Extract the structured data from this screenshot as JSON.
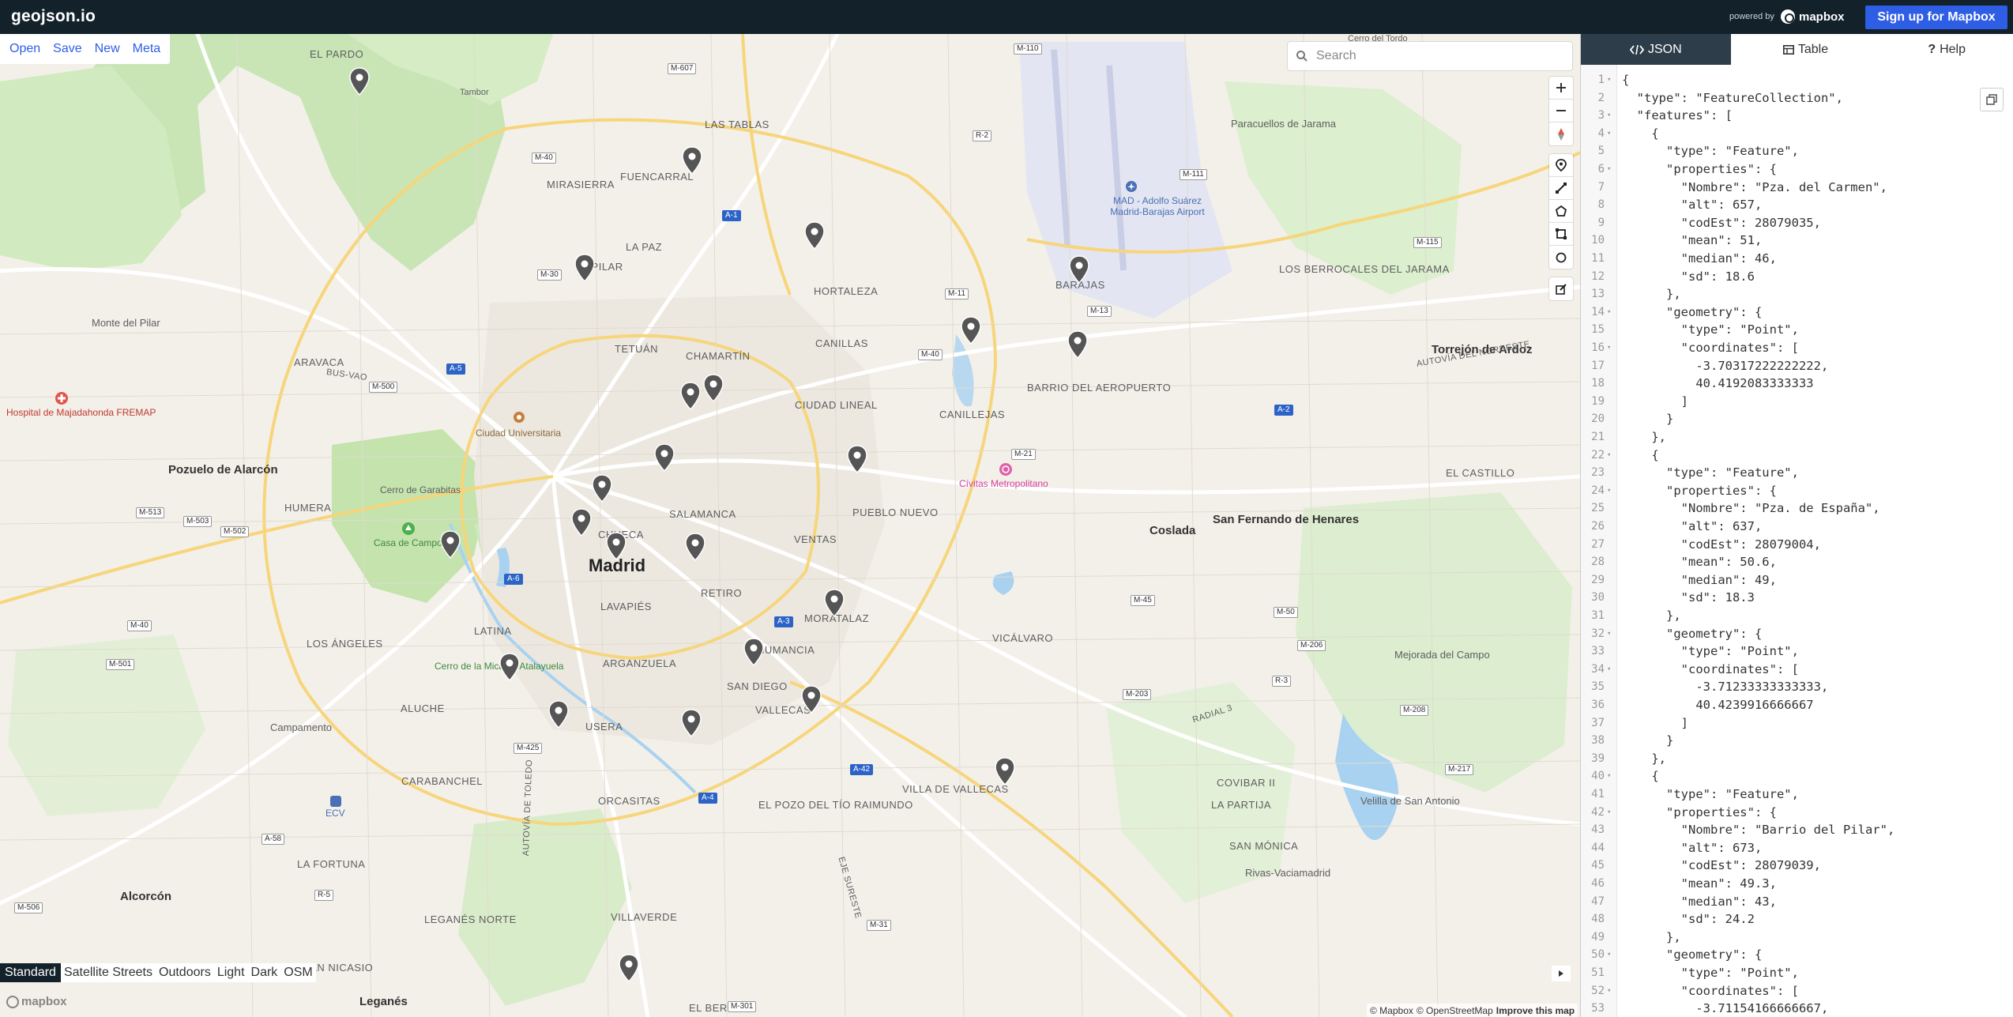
{
  "app": {
    "logo": "geojson.io",
    "powered_by": "powered by",
    "brand": "mapbox",
    "signup_label": "Sign up for Mapbox"
  },
  "file_menu": [
    "Open",
    "Save",
    "New",
    "Meta"
  ],
  "search": {
    "placeholder": "Search"
  },
  "map_styles": {
    "active": "Standard",
    "items": [
      "Standard",
      "Satellite Streets",
      "Outdoors",
      "Light",
      "Dark",
      "OSM"
    ]
  },
  "attribution": {
    "mapbox": "© Mapbox",
    "osm": "© OpenStreetMap",
    "improve": "Improve this map",
    "wordmark": "mapbox"
  },
  "map_labels": {
    "madrid": "Madrid",
    "places": [
      "EL PARDO",
      "LAS TABLAS",
      "FUENCARRAL",
      "MIRASIERRA",
      "EL PILAR",
      "LA PAZ",
      "HORTALEZA",
      "BARAJAS",
      "TETUÁN",
      "CHAMARTÍN",
      "CANILLAS",
      "CANILLEJAS",
      "CIUDAD LINEAL",
      "BARRIO DEL AEROPUERTO",
      "SALAMANCA",
      "PUEBLO NUEVO",
      "VENTAS",
      "RETIRO",
      "MORATALAZ",
      "VICÁLVARO",
      "LAVAPIÉS",
      "LATINA",
      "ARGANZUELA",
      "SAN DIEGO",
      "VALLECAS",
      "NUMANCIA",
      "USERA",
      "ALUCHE",
      "CARABANCHEL",
      "ORCASITAS",
      "EL POZO DEL TÍO RAIMUNDO",
      "VILLA DE VALLECAS",
      "VILLAVERDE",
      "LOS ÁNGELES",
      "HUMERA",
      "ARAVACA",
      "LOS BERROCALES DEL JARAMA",
      "EL CASTILLO",
      "COVIBAR II",
      "LA PARTIJA",
      "SAN MÓNICA",
      "LA FORTUNA",
      "LEGANÉS NORTE",
      "SAN NICASIO",
      "EL BERCIAL",
      "CHUECA"
    ],
    "cities": [
      "Pozuelo de Alarcón",
      "Torrejón de Ardoz",
      "Coslada",
      "San Fernando de Henares",
      "Mejorada del Campo",
      "Velilla de San Antonio",
      "Rivas-Vaciamadrid",
      "Alcorcón",
      "Leganés",
      "Paracuellos de Jarama",
      "Campamento",
      "Monte del Pilar"
    ],
    "pois": [
      "Hospital de Majadahonda FREMAP",
      "Ciudad Universitaria",
      "Cerro de Garabitas",
      "Casa de Campo",
      "Cerro de la Mica La Atalayuela",
      "Cívitas Metropolitano",
      "MAD - Adolfo Suárez Madrid-Barajas Airport",
      "ECV",
      "Tambor",
      "Cerro del Tordo"
    ],
    "roads": [
      "M-607",
      "M-110",
      "M-40",
      "R-2",
      "M-111",
      "M-30",
      "A-1",
      "M-11",
      "M-13",
      "M-115",
      "A-2",
      "M-40",
      "A-6",
      "M-500",
      "A-5",
      "M-513",
      "M-503",
      "M-502",
      "M-501",
      "M-40",
      "A-3",
      "R-3",
      "M-45",
      "M-50",
      "M-206",
      "M-203",
      "M-208",
      "M-217",
      "A-4",
      "A-42",
      "M-425",
      "M-21",
      "M-31",
      "R-5",
      "A-58",
      "M-506",
      "M-301",
      "AUTOVÍA DE TOLEDO",
      "EJE SURESTE",
      "AUTOVÍA DEL NORDESTE",
      "RADIAL 3",
      "BUS-VAO"
    ]
  },
  "panel": {
    "tabs": [
      {
        "label": "JSON",
        "icon": "code-icon",
        "active": true
      },
      {
        "label": "Table",
        "icon": "table-icon",
        "active": false
      },
      {
        "label": "Help",
        "icon": "question-icon",
        "active": false
      }
    ]
  },
  "code_lines": [
    {
      "n": "1",
      "fold": true,
      "text": "{"
    },
    {
      "n": "2",
      "fold": false,
      "text": "  \"type\": \"FeatureCollection\","
    },
    {
      "n": "3",
      "fold": true,
      "text": "  \"features\": ["
    },
    {
      "n": "4",
      "fold": true,
      "text": "    {"
    },
    {
      "n": "5",
      "fold": false,
      "text": "      \"type\": \"Feature\","
    },
    {
      "n": "6",
      "fold": true,
      "text": "      \"properties\": {"
    },
    {
      "n": "7",
      "fold": false,
      "text": "        \"Nombre\": \"Pza. del Carmen\","
    },
    {
      "n": "8",
      "fold": false,
      "text": "        \"alt\": 657,"
    },
    {
      "n": "9",
      "fold": false,
      "text": "        \"codEst\": 28079035,"
    },
    {
      "n": "10",
      "fold": false,
      "text": "        \"mean\": 51,"
    },
    {
      "n": "11",
      "fold": false,
      "text": "        \"median\": 46,"
    },
    {
      "n": "12",
      "fold": false,
      "text": "        \"sd\": 18.6"
    },
    {
      "n": "13",
      "fold": false,
      "text": "      },"
    },
    {
      "n": "14",
      "fold": true,
      "text": "      \"geometry\": {"
    },
    {
      "n": "15",
      "fold": false,
      "text": "        \"type\": \"Point\","
    },
    {
      "n": "16",
      "fold": true,
      "text": "        \"coordinates\": ["
    },
    {
      "n": "17",
      "fold": false,
      "text": "          -3.70317222222222,"
    },
    {
      "n": "18",
      "fold": false,
      "text": "          40.4192083333333"
    },
    {
      "n": "19",
      "fold": false,
      "text": "        ]"
    },
    {
      "n": "20",
      "fold": false,
      "text": "      }"
    },
    {
      "n": "21",
      "fold": false,
      "text": "    },"
    },
    {
      "n": "22",
      "fold": true,
      "text": "    {"
    },
    {
      "n": "23",
      "fold": false,
      "text": "      \"type\": \"Feature\","
    },
    {
      "n": "24",
      "fold": true,
      "text": "      \"properties\": {"
    },
    {
      "n": "25",
      "fold": false,
      "text": "        \"Nombre\": \"Pza. de España\","
    },
    {
      "n": "26",
      "fold": false,
      "text": "        \"alt\": 637,"
    },
    {
      "n": "27",
      "fold": false,
      "text": "        \"codEst\": 28079004,"
    },
    {
      "n": "28",
      "fold": false,
      "text": "        \"mean\": 50.6,"
    },
    {
      "n": "29",
      "fold": false,
      "text": "        \"median\": 49,"
    },
    {
      "n": "30",
      "fold": false,
      "text": "        \"sd\": 18.3"
    },
    {
      "n": "31",
      "fold": false,
      "text": "      },"
    },
    {
      "n": "32",
      "fold": true,
      "text": "      \"geometry\": {"
    },
    {
      "n": "33",
      "fold": false,
      "text": "        \"type\": \"Point\","
    },
    {
      "n": "34",
      "fold": true,
      "text": "        \"coordinates\": ["
    },
    {
      "n": "35",
      "fold": false,
      "text": "          -3.71233333333333,"
    },
    {
      "n": "36",
      "fold": false,
      "text": "          40.4239916666667"
    },
    {
      "n": "37",
      "fold": false,
      "text": "        ]"
    },
    {
      "n": "38",
      "fold": false,
      "text": "      }"
    },
    {
      "n": "39",
      "fold": false,
      "text": "    },"
    },
    {
      "n": "40",
      "fold": true,
      "text": "    {"
    },
    {
      "n": "41",
      "fold": false,
      "text": "      \"type\": \"Feature\","
    },
    {
      "n": "42",
      "fold": true,
      "text": "      \"properties\": {"
    },
    {
      "n": "43",
      "fold": false,
      "text": "        \"Nombre\": \"Barrio del Pilar\","
    },
    {
      "n": "44",
      "fold": false,
      "text": "        \"alt\": 673,"
    },
    {
      "n": "45",
      "fold": false,
      "text": "        \"codEst\": 28079039,"
    },
    {
      "n": "46",
      "fold": false,
      "text": "        \"mean\": 49.3,"
    },
    {
      "n": "47",
      "fold": false,
      "text": "        \"median\": 43,"
    },
    {
      "n": "48",
      "fold": false,
      "text": "        \"sd\": 24.2"
    },
    {
      "n": "49",
      "fold": false,
      "text": "      },"
    },
    {
      "n": "50",
      "fold": true,
      "text": "      \"geometry\": {"
    },
    {
      "n": "51",
      "fold": false,
      "text": "        \"type\": \"Point\","
    },
    {
      "n": "52",
      "fold": true,
      "text": "        \"coordinates\": ["
    },
    {
      "n": "53",
      "fold": false,
      "text": "          -3.71154166666667,"
    }
  ],
  "colors": {
    "topbar": "#12212a",
    "accent": "#2f5ee6",
    "tab_active": "#2e3d4a",
    "marker": "#555555",
    "water": "#a9d2f0",
    "park": "#c7e6b4"
  }
}
